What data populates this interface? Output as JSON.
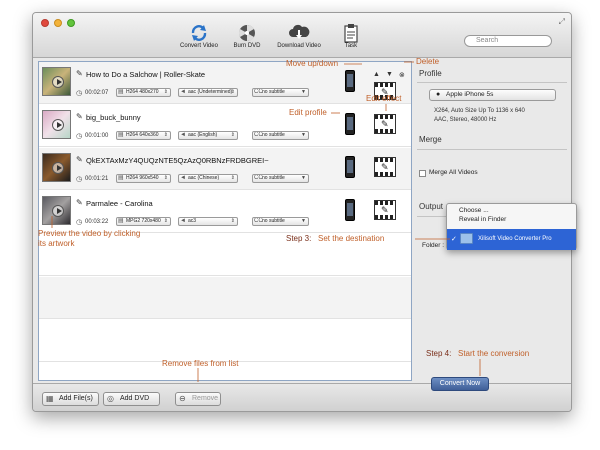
{
  "toolbar": {
    "tools": [
      {
        "label": "Convert Video",
        "icon": "convert-icon"
      },
      {
        "label": "Burn DVD",
        "icon": "burn-dvd-icon"
      },
      {
        "label": "Download Video",
        "icon": "download-cloud-icon"
      },
      {
        "label": "Task",
        "icon": "task-clipboard-icon"
      }
    ],
    "search_placeholder": "Search"
  },
  "files": [
    {
      "title": "How to Do a Salchow | Roller-Skate",
      "duration": "00:02:07",
      "video": "H264 480x270",
      "audio": "aac (Undetermined)",
      "subtitle": "no subtitle"
    },
    {
      "title": "big_buck_bunny",
      "duration": "00:01:00",
      "video": "H264 640x360",
      "audio": "aac (English)",
      "subtitle": "no subtitle"
    },
    {
      "title": "QkEXTAxMzY4QUQzNTE5QzAzQ0RBNzFRDBGREI~",
      "duration": "00:01:21",
      "video": "H264 960x540",
      "audio": "aac (Chinese)",
      "subtitle": "no subtitle"
    },
    {
      "title": "Parmalee - Carolina",
      "duration": "00:03:22",
      "video": "MPG2 720x480",
      "audio": "ac3",
      "subtitle": "no subtitle"
    }
  ],
  "cc_label": "CC",
  "annotations": {
    "move": "Move up/down",
    "delete": "Delete",
    "edit_effect": "Edit effect",
    "edit_profile": "Edit profile",
    "preview_line1": "Preview the video by clicking",
    "preview_line2": "its artwork",
    "step3_prefix": "Step 3:",
    "step3_text": "Set the destination",
    "remove_files": "Remove files from list",
    "step4_prefix": "Step 4:",
    "step4_text": "Start the conversion"
  },
  "side": {
    "profile_heading": "Profile",
    "profile_value": "Apple iPhone 5s",
    "spec_video": "X264, Auto Size Up To 1136 x 640",
    "spec_audio": "AAC, Stereo, 48000 Hz",
    "merge_heading": "Merge",
    "merge_label": "Merge All Videos",
    "output_heading": "Output",
    "folder_label": "Folder :"
  },
  "popup": {
    "choose": "Choose ...",
    "reveal": "Reveal in Finder",
    "selected": "Xilisoft Video Converter Pro"
  },
  "bottom": {
    "add_files": "Add File(s)",
    "add_dvd": "Add DVD",
    "remove": "Remove",
    "convert": "Convert Now"
  },
  "colors": {
    "annotation": "#c0602a",
    "step": "#7a2f1a",
    "selection": "#2d64d5",
    "convert_button": "#4a6aa6"
  }
}
